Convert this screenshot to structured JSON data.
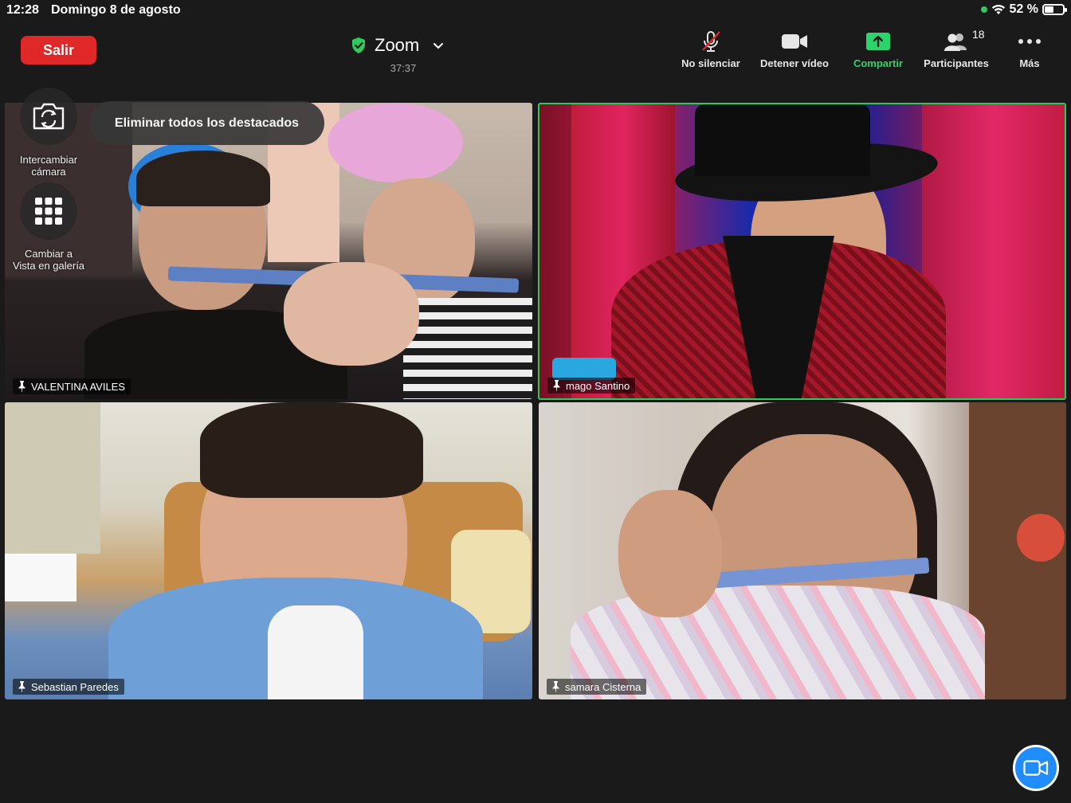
{
  "status_bar": {
    "time": "12:28",
    "date": "Domingo 8 de agosto",
    "battery": "52 %",
    "battery_level_percent": 52
  },
  "header": {
    "leave_label": "Salir",
    "title": "Zoom",
    "timer": "37:37"
  },
  "toolbar": {
    "mute_label": "No silenciar",
    "video_label": "Detener vídeo",
    "share_label": "Compartir",
    "participants_label": "Participantes",
    "participants_count": "18",
    "more_label": "Más"
  },
  "overlay": {
    "remove_pins_label": "Eliminar todos los destacados",
    "switch_camera_label_1": "Intercambiar",
    "switch_camera_label_2": "cámara",
    "gallery_label_1": "Cambiar a",
    "gallery_label_2": "Vista en galería"
  },
  "tiles": [
    {
      "name": "VALENTINA AVILES"
    },
    {
      "name": "mago Santino"
    },
    {
      "name": "Sebastian Paredes"
    },
    {
      "name": "samara Cisterna"
    }
  ],
  "colors": {
    "leave": "#e02828",
    "share": "#2dd36b",
    "active_speaker": "#2ec95a",
    "fab": "#1f8cff"
  }
}
